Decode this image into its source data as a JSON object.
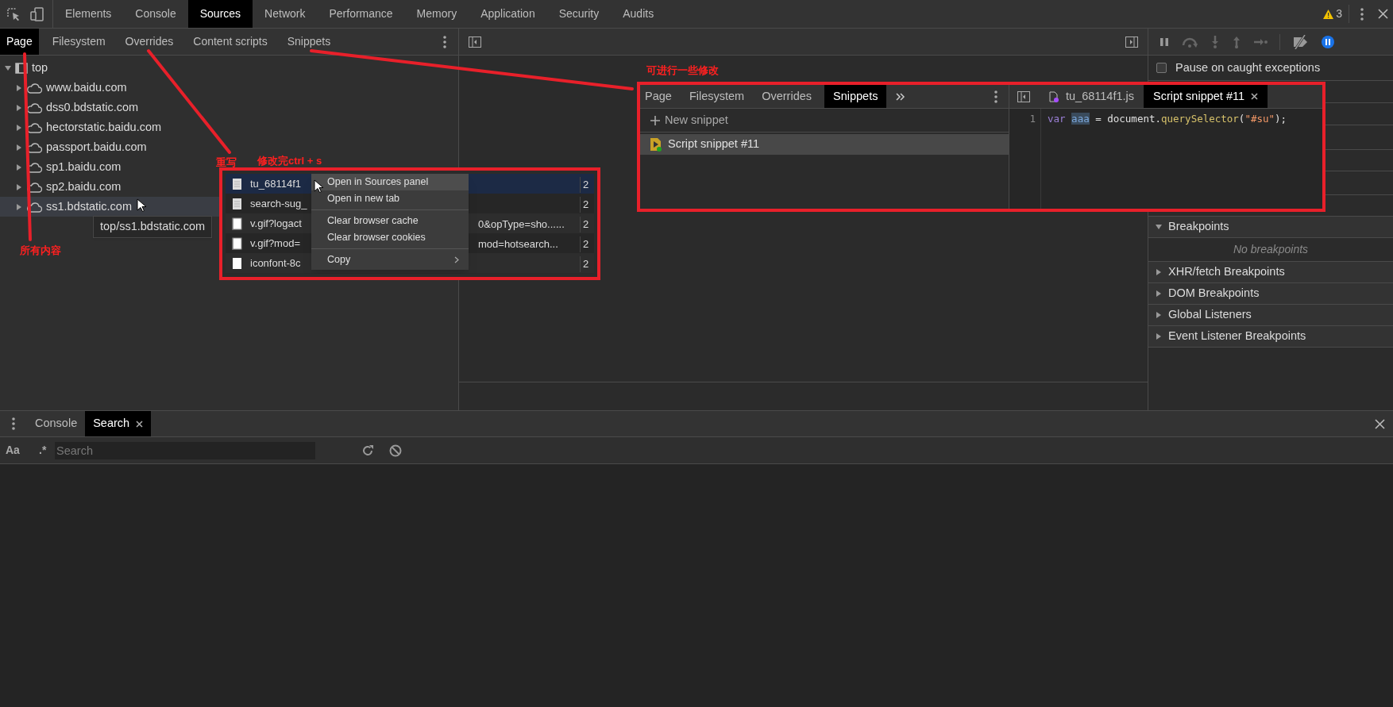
{
  "toolbar": {
    "tabs": [
      {
        "label": "Elements",
        "selected": false
      },
      {
        "label": "Console",
        "selected": false
      },
      {
        "label": "Sources",
        "selected": true
      },
      {
        "label": "Network",
        "selected": false
      },
      {
        "label": "Performance",
        "selected": false
      },
      {
        "label": "Memory",
        "selected": false
      },
      {
        "label": "Application",
        "selected": false
      },
      {
        "label": "Security",
        "selected": false
      },
      {
        "label": "Audits",
        "selected": false
      }
    ],
    "warnings": "3"
  },
  "navigator": {
    "tabs": [
      {
        "label": "Page",
        "selected": true
      },
      {
        "label": "Filesystem",
        "selected": false
      },
      {
        "label": "Overrides",
        "selected": false
      },
      {
        "label": "Content scripts",
        "selected": false
      },
      {
        "label": "Snippets",
        "selected": false
      }
    ],
    "tree": [
      {
        "label": "top",
        "kind": "frame",
        "expanded": true,
        "hovered": false,
        "children": [
          {
            "label": "www.baidu.com",
            "kind": "domain",
            "expanded": false,
            "hovered": false
          },
          {
            "label": "dss0.bdstatic.com",
            "kind": "domain",
            "expanded": false,
            "hovered": false
          },
          {
            "label": "hectorstatic.baidu.com",
            "kind": "domain",
            "expanded": false,
            "hovered": false
          },
          {
            "label": "passport.baidu.com",
            "kind": "domain",
            "expanded": false,
            "hovered": false
          },
          {
            "label": "sp1.baidu.com",
            "kind": "domain",
            "expanded": false,
            "hovered": false
          },
          {
            "label": "sp2.baidu.com",
            "kind": "domain",
            "expanded": false,
            "hovered": false
          },
          {
            "label": "ss1.bdstatic.com",
            "kind": "domain",
            "expanded": false,
            "hovered": true
          }
        ]
      }
    ],
    "tooltip": "top/ss1.bdstatic.com"
  },
  "debugger": {
    "pause_on_caught_exceptions": {
      "label": "Pause on caught exceptions",
      "checked": false
    },
    "sections": [
      {
        "label": "Breakpoints",
        "expanded": true,
        "empty_text": "No breakpoints"
      },
      {
        "label": "XHR/fetch Breakpoints",
        "expanded": false
      },
      {
        "label": "DOM Breakpoints",
        "expanded": false
      },
      {
        "label": "Global Listeners",
        "expanded": false
      },
      {
        "label": "Event Listener Breakpoints",
        "expanded": false
      }
    ]
  },
  "drawer": {
    "tabs": [
      {
        "label": "Console",
        "selected": false,
        "closable": false
      },
      {
        "label": "Search",
        "selected": true,
        "closable": true
      }
    ],
    "case_toggle": "Aa",
    "regex_toggle": ".*",
    "search": {
      "placeholder": "Search"
    }
  },
  "annotations": [
    {
      "text": "所有内容"
    },
    {
      "text": "重写"
    },
    {
      "text": "修改完ctrl + s"
    },
    {
      "text": "可进行一些修改"
    }
  ],
  "network_inset": {
    "rows": [
      {
        "name": "tu_68114f1",
        "column_2": "2",
        "selected": true,
        "kind": "doc"
      },
      {
        "name": "search-sug_",
        "column_2": "2",
        "selected": false,
        "kind": "doc"
      },
      {
        "name": "v.gif?logact",
        "tail": "0&opType=sho......",
        "column_2": "2",
        "selected": false,
        "kind": "image"
      },
      {
        "name": "v.gif?mod=",
        "tail": "mod=hotsearch...",
        "column_2": "2",
        "selected": false,
        "kind": "image"
      },
      {
        "name": "iconfont-8c",
        "column_2": "2",
        "selected": false,
        "kind": "blank"
      }
    ],
    "menu": [
      {
        "kind": "item",
        "label": "Open in Sources panel",
        "hovered": true
      },
      {
        "kind": "item",
        "label": "Open in new tab",
        "hovered": false
      },
      {
        "kind": "separator"
      },
      {
        "kind": "item",
        "label": "Clear browser cache",
        "hovered": false
      },
      {
        "kind": "item",
        "label": "Clear browser cookies",
        "hovered": false
      },
      {
        "kind": "separator"
      },
      {
        "kind": "submenu",
        "label": "Copy",
        "hovered": false
      }
    ]
  },
  "snippets_inset": {
    "tabs": [
      {
        "label": "Page",
        "selected": false
      },
      {
        "label": "Filesystem",
        "selected": false
      },
      {
        "label": "Overrides",
        "selected": false
      },
      {
        "label": "Snippets",
        "selected": true
      }
    ],
    "new_snippet": "New snippet",
    "items": [
      {
        "label": "Script snippet #11",
        "selected": true
      }
    ],
    "editor_tabs": [
      {
        "label": "tu_68114f1.js",
        "selected": false,
        "closable": false
      },
      {
        "label": "Script snippet #11",
        "selected": true,
        "closable": true
      }
    ],
    "code": [
      {
        "number": "1",
        "tokens": [
          {
            "text": "var",
            "kind": "keyword"
          },
          {
            "text": "aaa",
            "kind": "highlight",
            "space_before": true
          },
          {
            "text": " = document.",
            "kind": "plain"
          },
          {
            "text": "querySelector",
            "kind": "method"
          },
          {
            "text": "(",
            "kind": "plain"
          },
          {
            "text": "\"#su\"",
            "kind": "string"
          },
          {
            "text": ");",
            "kind": "plain"
          }
        ]
      }
    ]
  }
}
